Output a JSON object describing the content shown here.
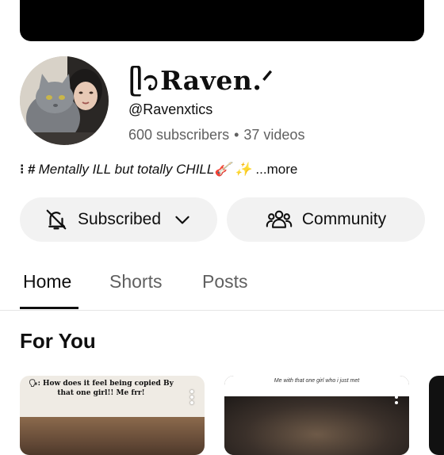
{
  "channel": {
    "name": "ᥫ᭡Raven.ᐟ",
    "handle": "@Ravenxtics",
    "subscribers": "600 subscribers",
    "videos": "37 videos",
    "separator": "•",
    "description_prefix": "⁝ #",
    "description": "Mentally ILL but totally CHILL🎸 ✨",
    "more_label": "...more"
  },
  "actions": {
    "subscribed_label": "Subscribed",
    "community_label": "Community"
  },
  "tabs": [
    {
      "label": "Home",
      "active": true
    },
    {
      "label": "Shorts",
      "active": false
    },
    {
      "label": "Posts",
      "active": false
    }
  ],
  "section": {
    "title": "For You"
  },
  "shorts": [
    {
      "caption": "🗣: How does it feel being copied By that one girl!! Me frr!"
    },
    {
      "caption": "Me with that one girl who i just met"
    }
  ],
  "icons": {
    "subscribed": "bell-off-icon",
    "dropdown": "chevron-down-icon",
    "community": "people-icon",
    "card_menu": "more-vert-icon"
  },
  "colors": {
    "background": "#ffffff",
    "button_bg": "#f2f2f2",
    "secondary_text": "#606060",
    "primary_text": "#0f0f0f"
  }
}
